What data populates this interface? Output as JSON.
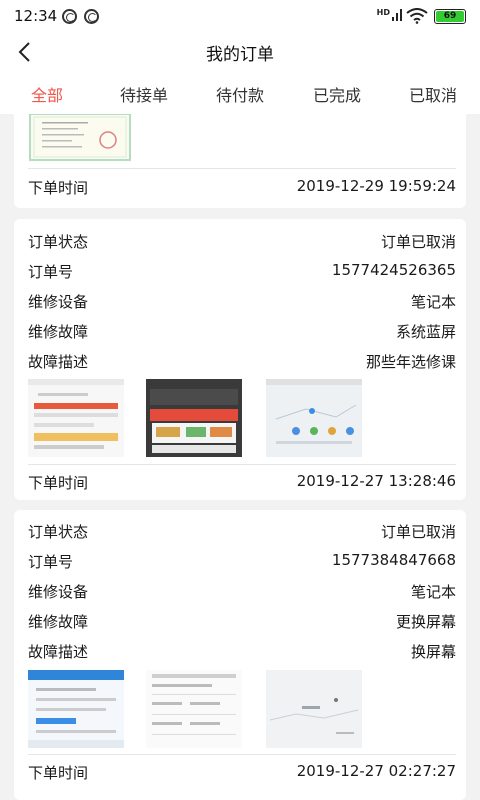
{
  "status_bar": {
    "time": "12:34",
    "network": "HD",
    "battery": "69"
  },
  "header": {
    "title": "我的订单"
  },
  "tabs": [
    "全部",
    "待接单",
    "待付款",
    "已完成",
    "已取消"
  ],
  "orders": [
    {
      "order_time_label": "下单时间",
      "order_time": "2019-12-29 19:59:24"
    },
    {
      "status_label": "订单状态",
      "status": "订单已取消",
      "number_label": "订单号",
      "number": "1577424526365",
      "device_label": "维修设备",
      "device": "笔记本",
      "fault_label": "维修故障",
      "fault": "系统蓝屏",
      "desc_label": "故障描述",
      "desc": "那些年选修课",
      "order_time_label": "下单时间",
      "order_time": "2019-12-27 13:28:46"
    },
    {
      "status_label": "订单状态",
      "status": "订单已取消",
      "number_label": "订单号",
      "number": "1577384847668",
      "device_label": "维修设备",
      "device": "笔记本",
      "fault_label": "维修故障",
      "fault": "更换屏幕",
      "desc_label": "故障描述",
      "desc": "换屏幕",
      "order_time_label": "下单时间",
      "order_time": "2019-12-27 02:27:27"
    }
  ],
  "colors": {
    "accent": "#f0564a",
    "background": "#f2f2f2"
  }
}
